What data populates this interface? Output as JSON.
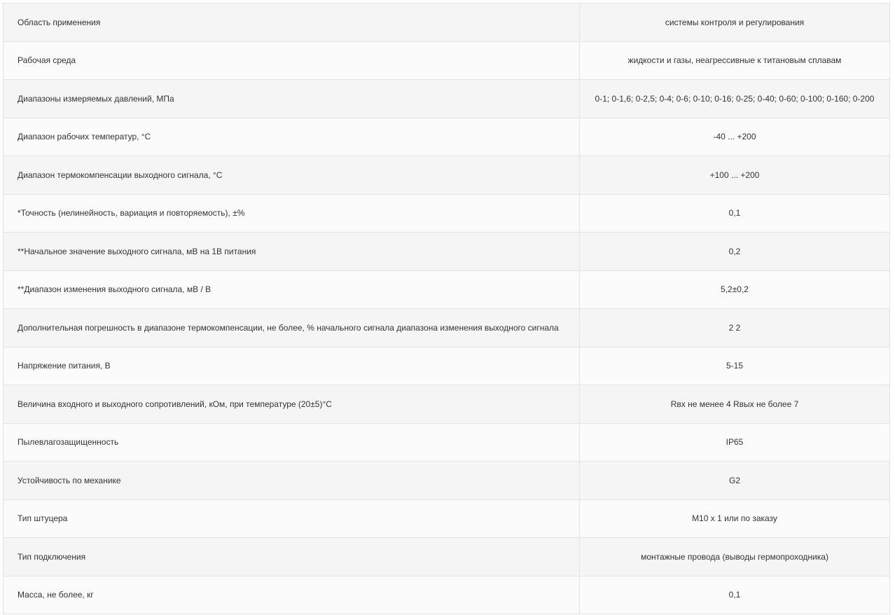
{
  "table": {
    "rows": [
      {
        "param": "Область применения",
        "value": "системы контроля и регулирования"
      },
      {
        "param": "Рабочая среда",
        "value": "жидкости и газы, неагрессивные к титановым сплавам"
      },
      {
        "param": "Диапазоны измеряемых давлений, МПа",
        "value": "0-1; 0-1,6; 0-2,5; 0-4; 0-6; 0-10; 0-16; 0-25; 0-40; 0-60; 0-100; 0-160; 0-200"
      },
      {
        "param": "Диапазон рабочих температур, °C",
        "value": "-40 ... +200"
      },
      {
        "param": "Диапазон термокомпенсации выходного сигнала, °C",
        "value": "+100 ... +200"
      },
      {
        "param": "*Точность (нелинейность, вариация и повторяемость), ±%",
        "value": "0,1"
      },
      {
        "param": "**Начальное значение выходного сигнала, мВ на 1В питания",
        "value": "0,2"
      },
      {
        "param": "**Диапазон изменения выходного сигнала, мВ / В",
        "value": "5,2±0,2"
      },
      {
        "param": "Дополнительная погрешность в диапазоне термокомпенсации, не более, % начального сигнала диапазона изменения выходного сигнала",
        "value": "2 2"
      },
      {
        "param": "Напряжение питания, В",
        "value": "5-15"
      },
      {
        "param": "Величина входного и выходного сопротивлений, кОм, при температуре (20±5)°C",
        "value": "Rвх не менее 4 Rвых не более 7"
      },
      {
        "param": "Пылевлагозащищенность",
        "value": "IP65"
      },
      {
        "param": "Устойчивость по механике",
        "value": "G2"
      },
      {
        "param": "Тип штуцера",
        "value": "М10 х 1 или по заказу"
      },
      {
        "param": "Тип подключения",
        "value": "монтажные провода (выводы гермопроходника)"
      },
      {
        "param": "Масса, не более, кг",
        "value": "0,1"
      }
    ]
  }
}
